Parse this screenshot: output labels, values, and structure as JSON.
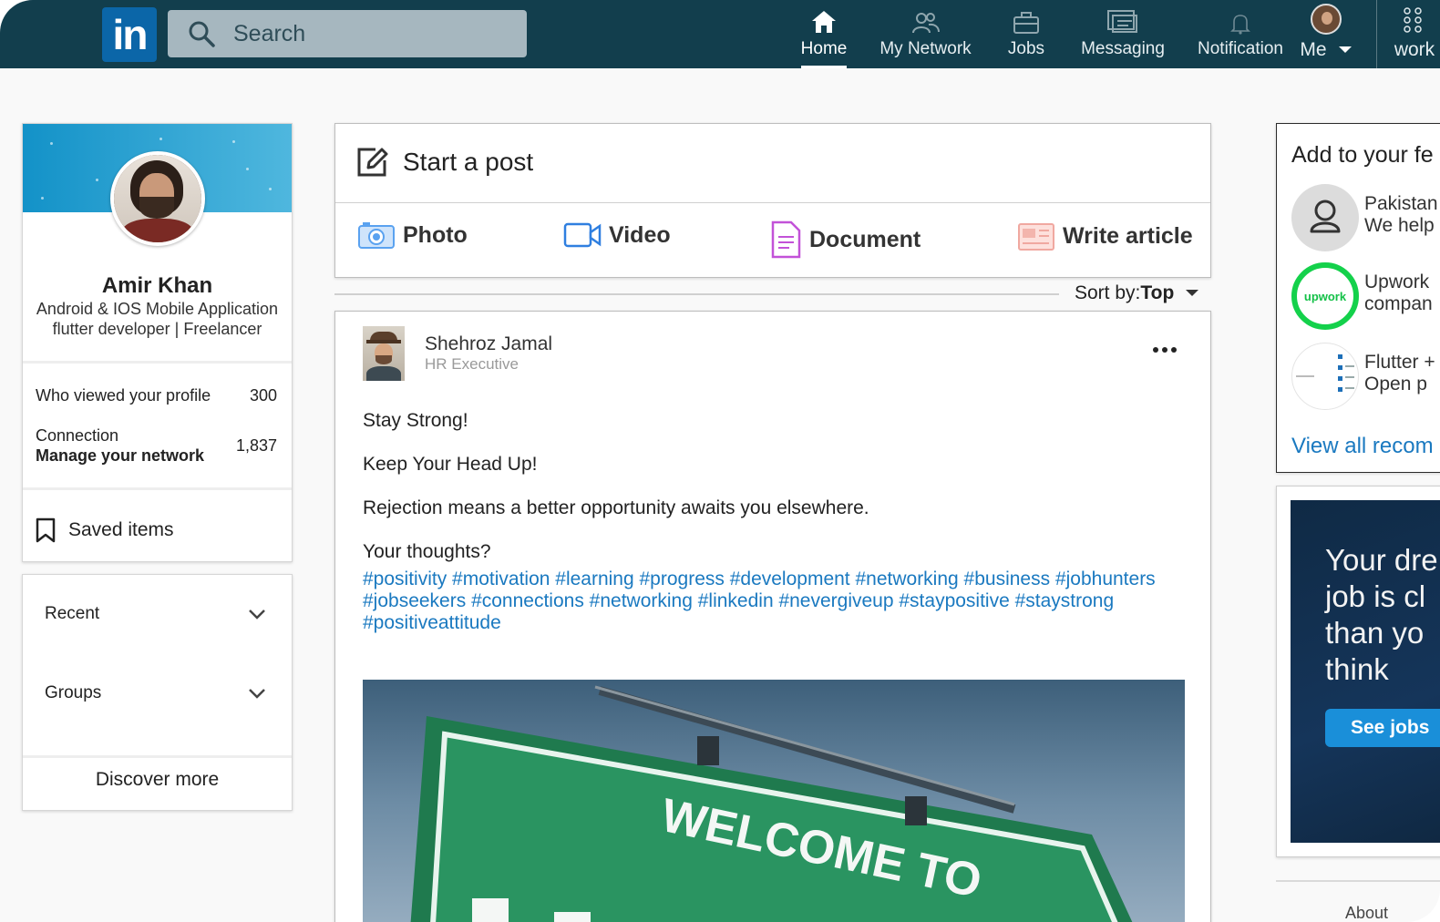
{
  "nav": {
    "logo_text": "in",
    "search_placeholder": "Search",
    "items": [
      {
        "label": "Home",
        "icon": "home-icon",
        "active": true
      },
      {
        "label": "My Network",
        "icon": "network-icon"
      },
      {
        "label": "Jobs",
        "icon": "briefcase-icon"
      },
      {
        "label": "Messaging",
        "icon": "messaging-icon"
      },
      {
        "label": "Notification",
        "icon": "bell-icon"
      },
      {
        "label": "Me",
        "icon": "avatar"
      }
    ],
    "work_label": "work",
    "colors": {
      "bar": "#123e4d",
      "logo": "#0b66a8"
    }
  },
  "profile": {
    "name": "Amir Khan",
    "headline": "Android & IOS Mobile Application flutter developer | Freelancer",
    "viewed_label": "Who viewed your profile",
    "viewed_value": "300",
    "connection_label": "Connection",
    "manage_label": "Manage your network",
    "connection_value": "1,837",
    "saved_label": "Saved items"
  },
  "groups": {
    "recent_label": "Recent",
    "groups_label": "Groups",
    "discover_label": "Discover more"
  },
  "composer": {
    "start_label": "Start a post",
    "actions": [
      "Photo",
      "Video",
      "Document",
      "Write article"
    ]
  },
  "sort": {
    "label": "Sort by:",
    "value": "Top"
  },
  "post": {
    "author": "Shehroz Jamal",
    "role": "HR Executive",
    "lines": [
      "Stay Strong!",
      "Keep Your Head Up!",
      "Rejection means a better opportunity awaits you elsewhere.",
      "Your thoughts?"
    ],
    "hashtags": "#positivity #motivation #learning #progress #development #networking #business #jobhunters #jobseekers #connections #networking #linkedin #nevergiveup #staypositive #staystrong #positiveattitude",
    "image_text": "WELCOME TO"
  },
  "feed": {
    "title": "Add to your fe",
    "items": [
      {
        "line1": "Pakistan",
        "line2": "We help"
      },
      {
        "line1": "Upwork",
        "line2": "compan",
        "logo_text": "upwork"
      },
      {
        "line1": "Flutter +",
        "line2": "Open p"
      }
    ],
    "view_all": "View all recom"
  },
  "ad": {
    "text_lines": [
      "Your dre",
      "job is cl",
      "than yo",
      "think"
    ],
    "button": "See jobs"
  },
  "footer": {
    "about": "About"
  }
}
